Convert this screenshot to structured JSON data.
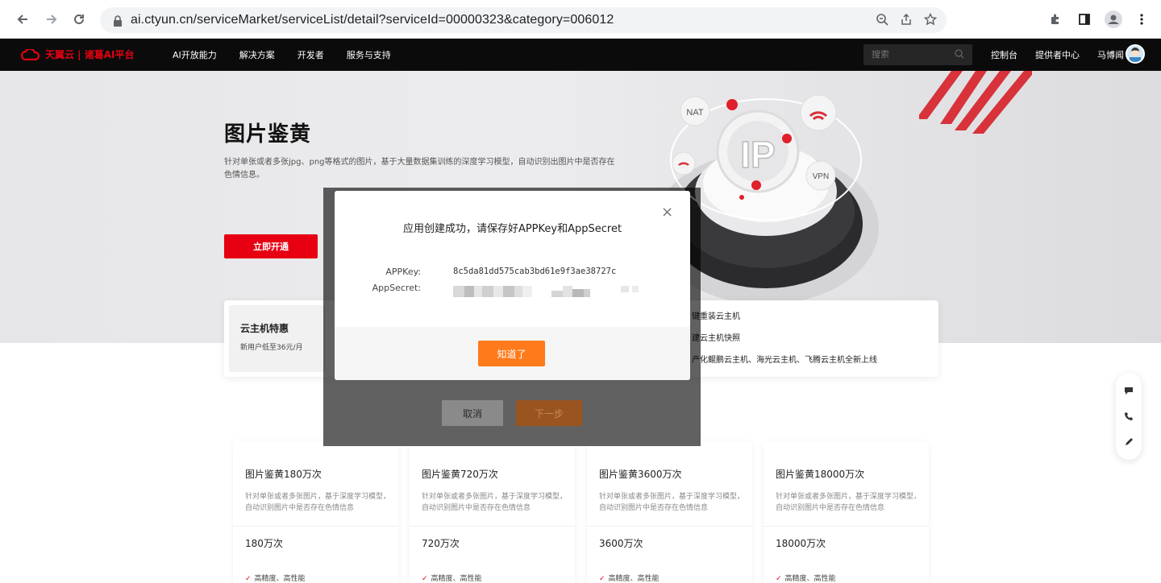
{
  "browser": {
    "url": "ai.ctyun.cn/serviceMarket/serviceList/detail?serviceId=00000323&category=006012"
  },
  "nav": {
    "logo": "天翼云 | 诸葛AI平台",
    "menu": [
      "AI开放能力",
      "解决方案",
      "开发者",
      "服务与支持"
    ],
    "search_placeholder": "搜索",
    "links": [
      "控制台",
      "提供者中心",
      "马博闻"
    ]
  },
  "hero": {
    "title": "图片鉴黄",
    "description": "针对单张或者多张jpg、png等格式的图片，基于大量数据集训练的深度学习模型，自动识别出图片中是否存在色情信息。",
    "cta": "立即开通",
    "art_labels": [
      "NAT",
      "IP",
      "VPN"
    ]
  },
  "promo": {
    "card_title": "云主机特惠",
    "card_sub": "新用户低至36元/月",
    "lines": [
      "键重装云主机",
      "建云主机快照",
      "产化鲲鹏云主机、海光云主机、飞腾云主机全新上线"
    ]
  },
  "modal": {
    "title": "应用创建成功，请保存好APPKey和AppSecret",
    "appkey_label": "APPKey:",
    "appkey_value": "8c5da81dd575cab3bd61e9f3ae38727c",
    "appsecret_label": "AppSecret:",
    "ok_button": "知道了"
  },
  "underlying_dialog": {
    "cancel": "取消",
    "next": "下一步"
  },
  "cards": [
    {
      "name": "图片鉴黄180万次",
      "desc": "针对单张或者多张图片，基于深度学习模型，自动识别图片中是否存在色情信息",
      "qty": "180万次",
      "feat": "高精度、高性能"
    },
    {
      "name": "图片鉴黄720万次",
      "desc": "针对单张或者多张图片，基于深度学习模型，自动识别图片中是否存在色情信息",
      "qty": "720万次",
      "feat": "高精度、高性能"
    },
    {
      "name": "图片鉴黄3600万次",
      "desc": "针对单张或者多张图片，基于深度学习模型，自动识别图片中是否存在色情信息",
      "qty": "3600万次",
      "feat": "高精度、高性能"
    },
    {
      "name": "图片鉴黄18000万次",
      "desc": "针对单张或者多张图片，基于深度学习模型，自动识别图片中是否存在色情信息",
      "qty": "18000万次",
      "feat": "高精度、高性能"
    }
  ],
  "colors": {
    "brand_red": "#e60012",
    "ok_orange": "#ff7a1a",
    "nav_bg": "#0b0b0b"
  }
}
